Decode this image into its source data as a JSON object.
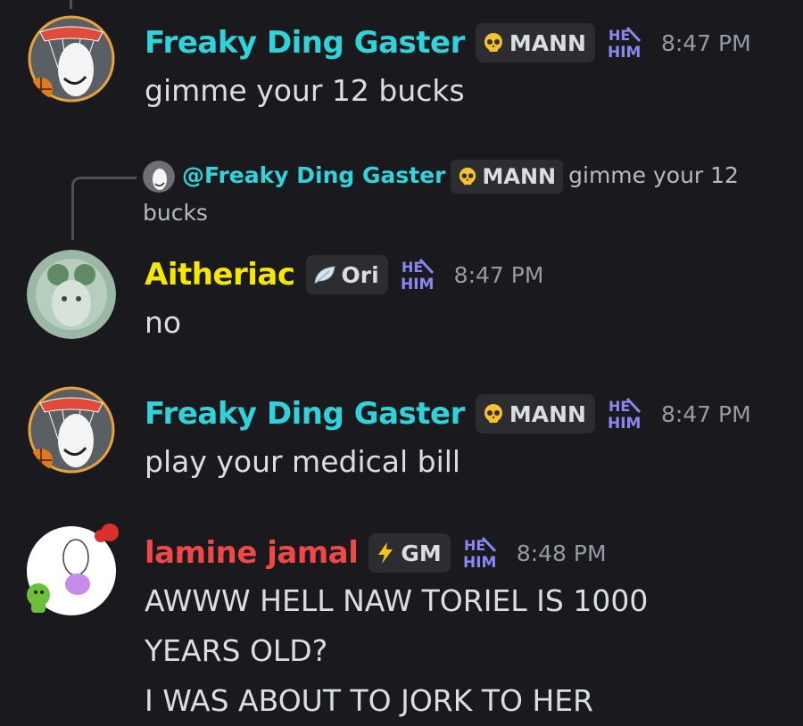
{
  "colors": {
    "background": "#1a1a1e",
    "gaster_name": "#2fd3d9",
    "aitheriac_name": "#f5e800",
    "lamine_name": "#f04747",
    "pronoun_badge": "#8b86f0"
  },
  "messages": [
    {
      "author": "Freaky Ding Gaster",
      "tag_icon": "skull-icon",
      "tag_label": "MANN",
      "pronoun_top": "HE",
      "pronoun_bottom": "HIM",
      "time": "8:47 PM",
      "lines": [
        "gimme your 12 bucks"
      ]
    },
    {
      "reply": {
        "mention": "@Freaky Ding Gaster",
        "tag_icon": "skull-icon",
        "tag_label": "MANN",
        "text_a": "gimme your 12",
        "text_b": "bucks"
      },
      "author": "Aitheriac",
      "tag_icon": "leaf-icon",
      "tag_label": "Ori",
      "pronoun_top": "HE",
      "pronoun_bottom": "HIM",
      "time": "8:47 PM",
      "lines": [
        "no"
      ]
    },
    {
      "author": "Freaky Ding Gaster",
      "tag_icon": "skull-icon",
      "tag_label": "MANN",
      "pronoun_top": "HE",
      "pronoun_bottom": "HIM",
      "time": "8:47 PM",
      "lines": [
        "play your medical bill"
      ]
    },
    {
      "author": "lamine jamal",
      "tag_icon": "lightning-icon",
      "tag_label": "GM",
      "pronoun_top": "HE",
      "pronoun_bottom": "HIM",
      "time": "8:48 PM",
      "lines": [
        "AWWW HELL NAW TORIEL IS 1000",
        "YEARS OLD?",
        "I WAS ABOUT TO JORK TO HER"
      ]
    }
  ]
}
